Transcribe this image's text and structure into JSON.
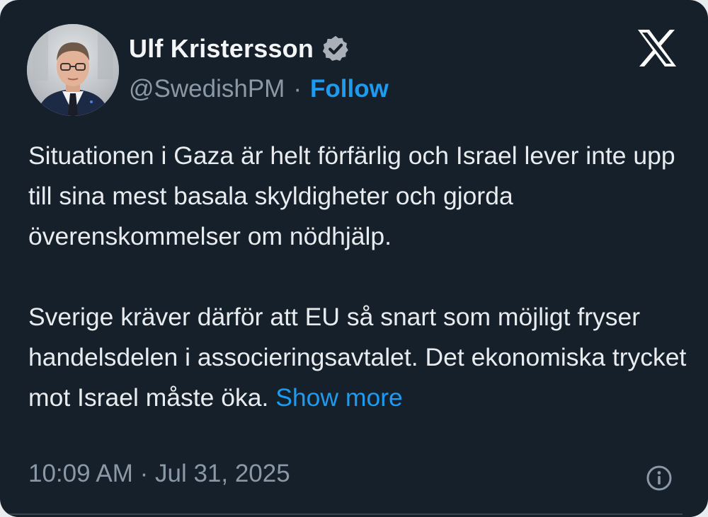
{
  "author": {
    "name": "Ulf Kristersson",
    "handle": "@SwedishPM",
    "separator": "·",
    "follow_label": "Follow"
  },
  "tweet": {
    "paragraph_1": "Situationen i Gaza är helt förfärlig och Israel lever inte upp till sina mest basala skyldigheter och gjorda överenskommelser om nödhjälp.",
    "paragraph_2": "Sverige kräver därför att EU så snart som möjligt fryser handelsdelen i associeringsavtalet. Det ekonomiska trycket mot Israel måste öka.",
    "show_more_label": "Show more",
    "timestamp": "10:09 AM · Jul 31, 2025"
  },
  "icons": {
    "verified": "verified-badge-icon",
    "logo": "x-logo-icon",
    "info": "info-icon"
  },
  "colors": {
    "background": "#15202b",
    "text": "#e9ecef",
    "secondary_text": "#8b98a5",
    "accent": "#1d9bf0"
  }
}
